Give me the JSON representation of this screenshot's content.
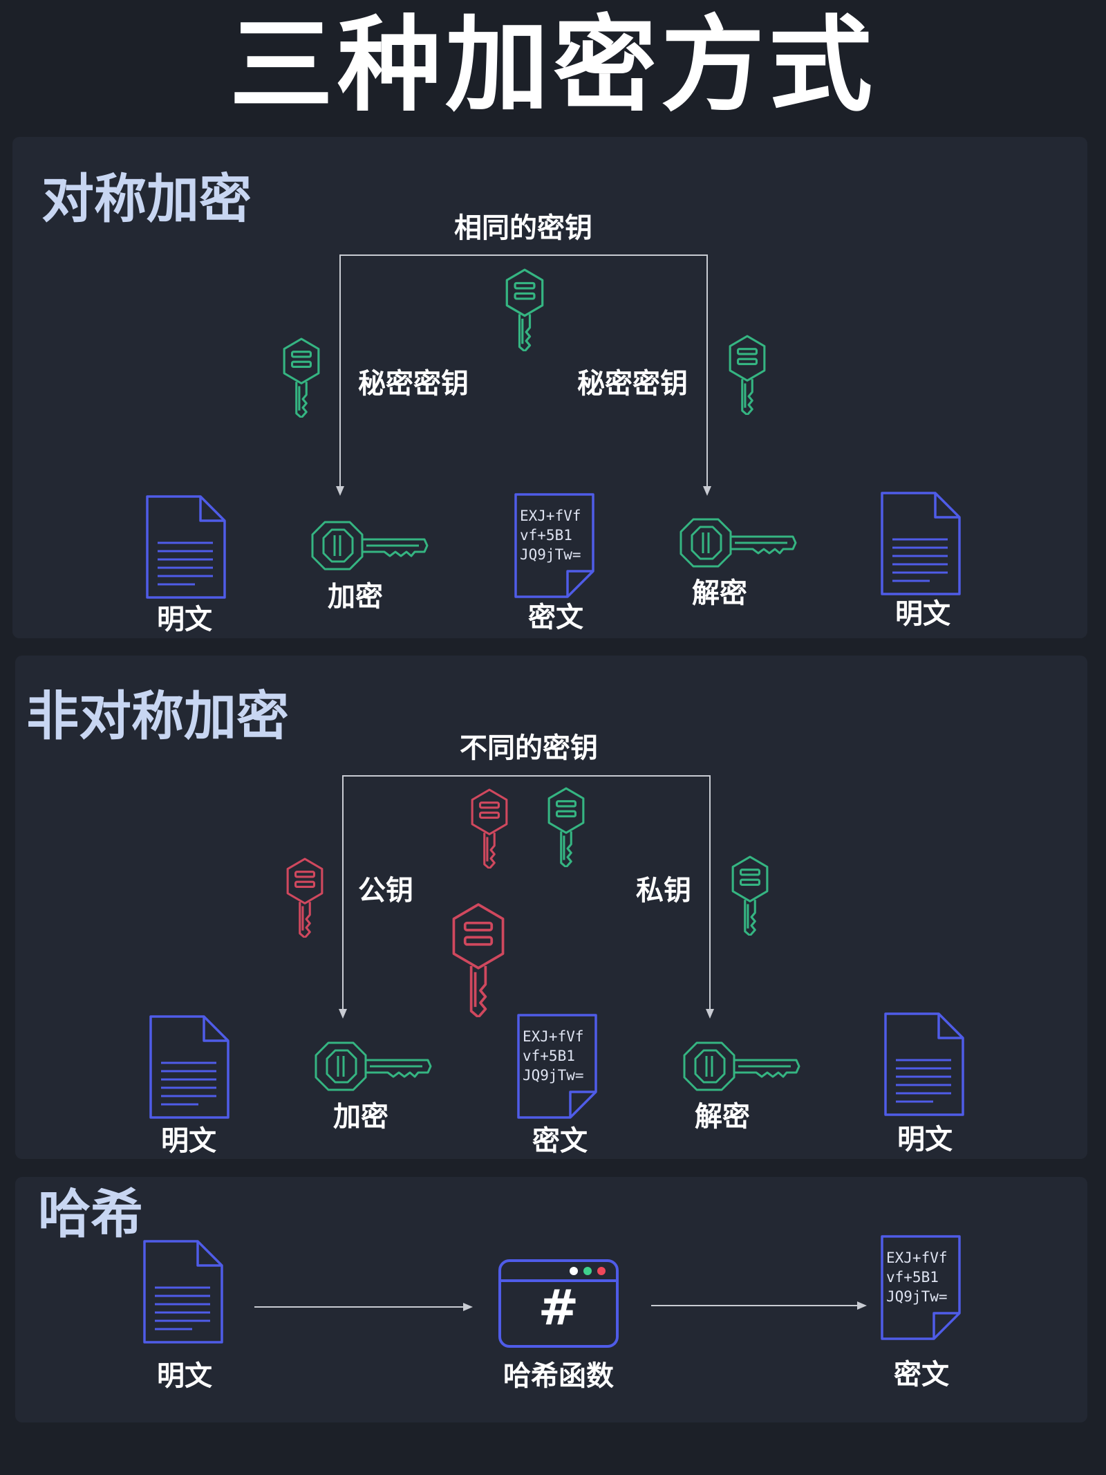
{
  "title": "三种加密方式",
  "symmetric": {
    "title": "对称加密",
    "key_caption": "相同的密钥",
    "left_key_label": "秘密密钥",
    "right_key_label": "秘密密钥",
    "plaintext_left": "明文",
    "encrypt": "加密",
    "ciphertext": "密文",
    "decrypt": "解密",
    "plaintext_right": "明文",
    "cipher_lines": [
      "EXJ+fVf",
      "vf+5B1",
      "JQ9jTw="
    ]
  },
  "asymmetric": {
    "title": "非对称加密",
    "key_caption": "不同的密钥",
    "left_key_label": "公钥",
    "right_key_label": "私钥",
    "plaintext_left": "明文",
    "encrypt": "加密",
    "ciphertext": "密文",
    "decrypt": "解密",
    "plaintext_right": "明文",
    "cipher_lines": [
      "EXJ+fVf",
      "vf+5B1",
      "JQ9jTw="
    ]
  },
  "hash": {
    "title": "哈希",
    "plaintext": "明文",
    "function": "哈希函数",
    "function_symbol": "#",
    "ciphertext": "密文",
    "cipher_lines": [
      "EXJ+fVf",
      "vf+5B1",
      "JQ9jTw="
    ]
  },
  "colors": {
    "green_key": "#35b582",
    "red_key": "#d0485e",
    "document": "#4f5ce8",
    "hash_dots": [
      "#ffffff",
      "#3fd18c",
      "#f0485a"
    ]
  }
}
